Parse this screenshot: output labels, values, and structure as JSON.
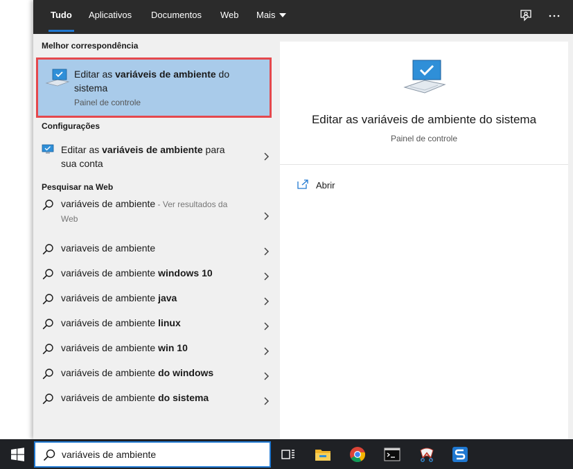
{
  "tabs": [
    {
      "label": "Tudo",
      "active": true
    },
    {
      "label": "Aplicativos",
      "active": false
    },
    {
      "label": "Documentos",
      "active": false
    },
    {
      "label": "Web",
      "active": false
    },
    {
      "label": "Mais",
      "active": false
    }
  ],
  "topbar_icons": [
    "feedback-icon",
    "more-options-icon"
  ],
  "sections": {
    "best_match": "Melhor correspondência",
    "settings": "Configurações",
    "web": "Pesquisar na Web"
  },
  "best_match": {
    "title_pre": "Editar as ",
    "title_bold": "variáveis de ambiente",
    "title_post": " do sistema",
    "subtitle": "Painel de controle"
  },
  "settings_item": {
    "pre": "Editar as ",
    "bold": "variáveis de ambiente",
    "post": " para sua conta"
  },
  "web_results": [
    {
      "pre": "variáveis de ambiente",
      "bold": "",
      "sub": " - Ver resultados da Web"
    },
    {
      "pre": "variaveis de ambiente",
      "bold": "",
      "sub": ""
    },
    {
      "pre": "variáveis de ambiente ",
      "bold": "windows 10",
      "sub": ""
    },
    {
      "pre": "variáveis de ambiente ",
      "bold": "java",
      "sub": ""
    },
    {
      "pre": "variáveis de ambiente ",
      "bold": "linux",
      "sub": ""
    },
    {
      "pre": "variáveis de ambiente ",
      "bold": "win 10",
      "sub": ""
    },
    {
      "pre": "variáveis de ambiente ",
      "bold": "do windows",
      "sub": ""
    },
    {
      "pre": "variáveis de ambiente ",
      "bold": "do sistema",
      "sub": ""
    }
  ],
  "preview": {
    "title": "Editar as variáveis de ambiente do sistema",
    "subtitle": "Painel de controle",
    "open_label": "Abrir"
  },
  "taskbar": {
    "search_value": "variáveis de ambiente",
    "apps": [
      "task-view-icon",
      "file-explorer-icon",
      "chrome-icon",
      "terminal-icon",
      "snipping-tool-icon",
      "app-s-icon"
    ]
  },
  "colors": {
    "accent": "#1f78d1",
    "highlight": "#a9cbea",
    "highlight_border": "#e5484d",
    "topbar": "#2b2b2b",
    "taskbar": "#1f2125"
  }
}
